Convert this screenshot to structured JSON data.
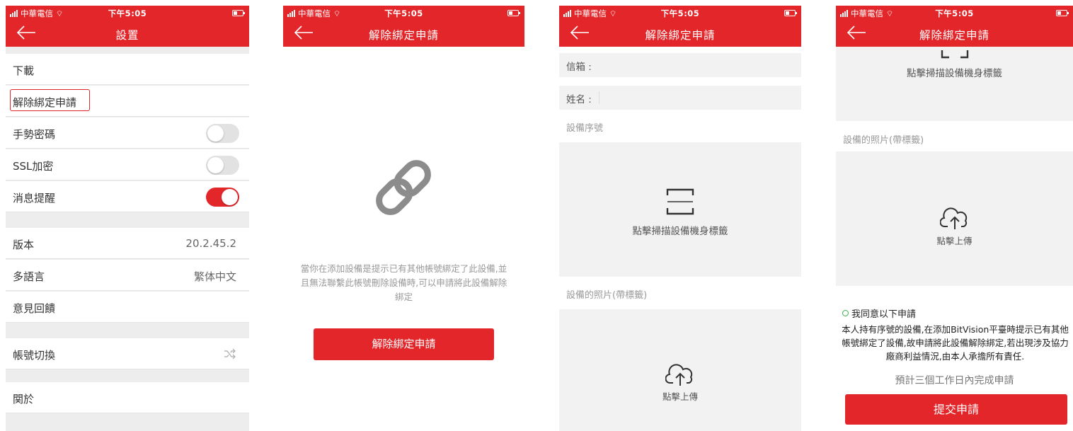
{
  "status_bar": {
    "carrier": "中華電信",
    "time": "下午5:05"
  },
  "colors": {
    "accent": "#e3262a",
    "agree_green": "#37b24d"
  },
  "settings_screen": {
    "title": "設置",
    "items": {
      "download": "下載",
      "unbind_request": "解除綁定申請",
      "gesture_password": "手勢密碼",
      "ssl_encryption": "SSL加密",
      "notification": "消息提醒",
      "version_label": "版本",
      "version_value": "20.2.45.2",
      "language_label": "多語言",
      "language_value": "繁体中文",
      "feedback": "意見回饋",
      "switch_account": "帳號切換",
      "about": "関於"
    },
    "toggles": {
      "gesture_password": false,
      "ssl_encryption": false,
      "notification": true
    },
    "icons": {
      "switch_account": "shuffle-icon"
    }
  },
  "unbind_intro_screen": {
    "title": "解除綁定申請",
    "icon": "link-icon",
    "description": "當你在添加設備是提示已有其他帳號綁定了此設備,並且無法聯繫此帳號刪除設備時,可以申請將此設備解除綁定",
    "button": "解除綁定申請"
  },
  "unbind_form_screen": {
    "title": "解除綁定申請",
    "email_label": "信箱 :",
    "name_label": "姓名 :",
    "serial_section": "設備序號",
    "scan_label": "點擊掃描設備機身標籤",
    "photo_section": "設備的照片(帶標籤)",
    "upload_label": "點擊上傳"
  },
  "unbind_form_bottom_screen": {
    "title": "解除綁定申請",
    "scan_label": "點擊掃描設備機身標籤",
    "photo_section": "設備的照片(帶標籤)",
    "upload_label": "點擊上傳",
    "agree_label": "我同意以下申請",
    "terms": "本人持有序號的設備,在添加BitVision平臺時提示已有其他帳號綁定了設備,故申請將此設備解除綁定,若出現涉及協力廠商利益情況,由本人承擔所有責任.",
    "eta": "預計三個工作日內完成申請",
    "submit": "提交申請"
  }
}
